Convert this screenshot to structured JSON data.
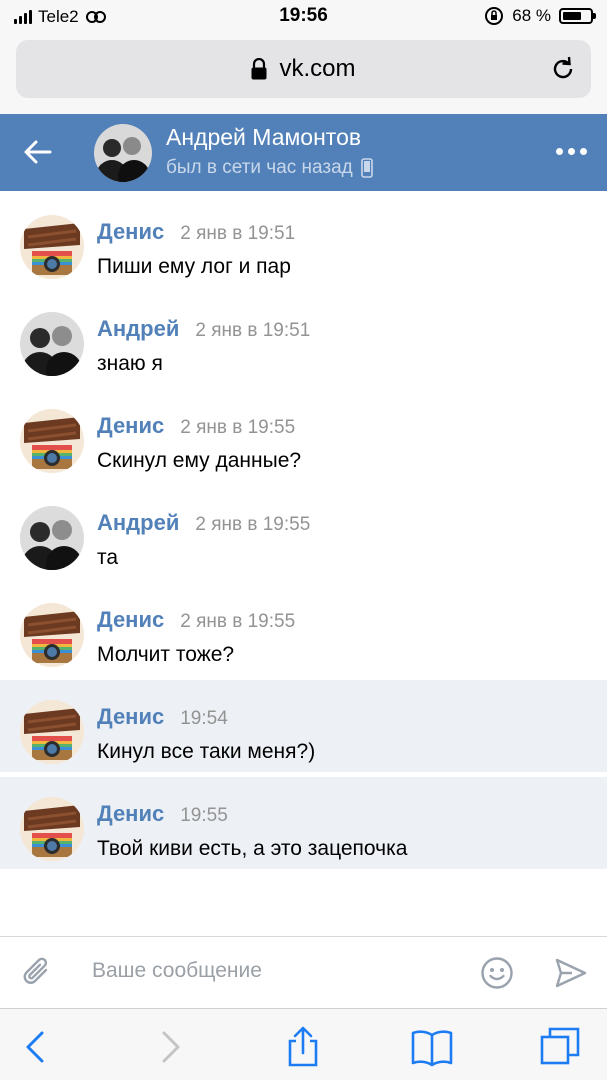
{
  "status_bar": {
    "carrier": "Tele2",
    "time": "19:56",
    "battery_percent": "68 %",
    "battery_level": 0.68
  },
  "browser": {
    "url": "vk.com"
  },
  "chat": {
    "title": "Андрей Мамонтов",
    "status": "был в сети час назад"
  },
  "messages": [
    {
      "author": "Денис",
      "time": "2 янв в 19:51",
      "text": "Пиши ему лог и пар",
      "avatar": "chocolate-camera-avatar",
      "unread": false
    },
    {
      "author": "Андрей",
      "time": "2 янв в 19:51",
      "text": "знаю я",
      "avatar": "bw-photo-avatar",
      "unread": false
    },
    {
      "author": "Денис",
      "time": "2 янв в 19:55",
      "text": "Скинул ему данные?",
      "avatar": "chocolate-camera-avatar",
      "unread": false
    },
    {
      "author": "Андрей",
      "time": "2 янв в 19:55",
      "text": "та",
      "avatar": "bw-photo-avatar",
      "unread": false
    },
    {
      "author": "Денис",
      "time": "2 янв в 19:55",
      "text": "Молчит тоже?",
      "avatar": "chocolate-camera-avatar",
      "unread": false
    },
    {
      "author": "Денис",
      "time": "19:54",
      "text": "Кинул все таки меня?)",
      "avatar": "chocolate-camera-avatar",
      "unread": true
    },
    {
      "author": "Денис",
      "time": "19:55",
      "text": "Твой киви есть, а это зацепочка",
      "avatar": "chocolate-camera-avatar",
      "unread": true
    }
  ],
  "composer": {
    "placeholder": "Ваше сообщение"
  },
  "colors": {
    "vk_blue": "#5181b8",
    "unread_bg": "#edf0f5",
    "ios_blue": "#1e7cf2"
  }
}
